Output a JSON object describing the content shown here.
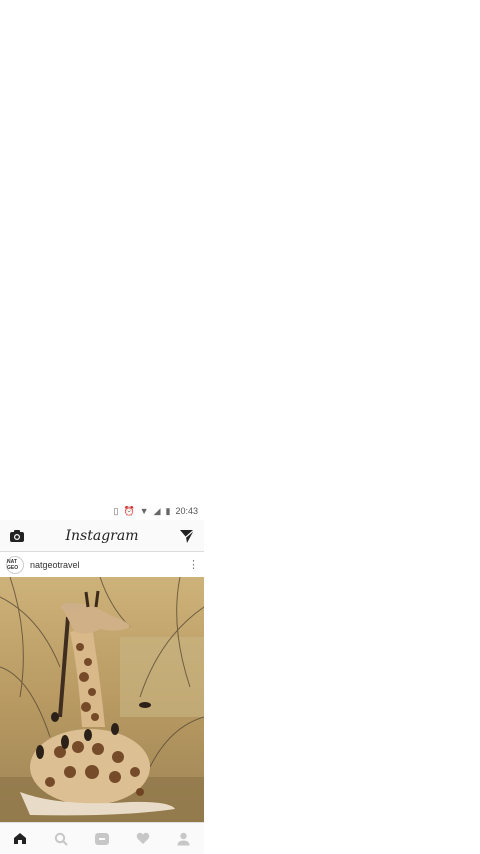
{
  "status_bar": {
    "time": "20:43",
    "icons": [
      "vibrate-icon",
      "alarm-icon",
      "wifi-icon",
      "signal-icon",
      "battery-icon"
    ]
  },
  "app_bar": {
    "title": "Instagram",
    "left_icon": "camera-icon",
    "right_icon": "direct-message-icon"
  },
  "post": {
    "avatar_text": "NAT GEO",
    "username": "natgeotravel",
    "more_icon": "more-vertical-icon",
    "image_subject": "young giraffe resting among dry branches with oxpecker birds"
  },
  "bottom_nav": {
    "items": [
      "home-icon",
      "search-icon",
      "camera-tab-icon",
      "activity-heart-icon",
      "profile-icon"
    ],
    "active": "home-icon"
  },
  "colors": {
    "background": "#ffffff",
    "bar": "#fafafa",
    "icon_dark": "#222222",
    "icon_inactive": "#c7c7c7"
  }
}
